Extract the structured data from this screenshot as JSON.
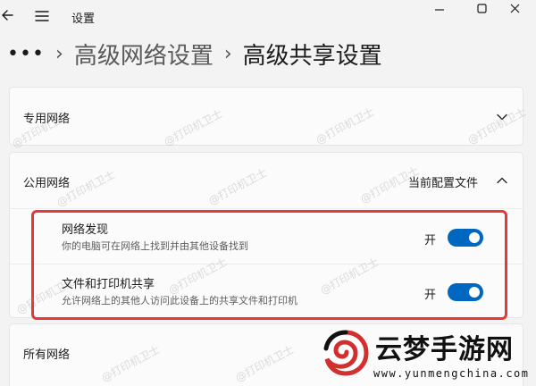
{
  "window": {
    "title": "设置",
    "icons": [
      "back-arrow-icon",
      "hamburger-menu-icon",
      "minimize-icon",
      "maximize-icon",
      "close-icon"
    ]
  },
  "breadcrumb": {
    "more": "•••",
    "items": [
      "高级网络设置",
      "高级共享设置"
    ]
  },
  "sections": {
    "private": {
      "label": "专用网络",
      "expanded": false
    },
    "public": {
      "label": "公用网络",
      "current_profile": "当前配置文件",
      "expanded": true,
      "settings": [
        {
          "title": "网络发现",
          "description": "你的电脑可在网络上找到并由其他设备找到",
          "state": "开",
          "on": true
        },
        {
          "title": "文件和打印机共享",
          "description": "允许网络上的其他人访问此设备上的共享文件和打印机",
          "state": "开",
          "on": true
        }
      ]
    },
    "all": {
      "label": "所有网络"
    }
  },
  "watermark": "@打印机卫士",
  "brand": {
    "name": "云梦手游网",
    "url": "www.yunmengchina.com"
  },
  "colors": {
    "accent": "#0067c0",
    "highlight": "#e53935",
    "background": "#f3f3f3",
    "card": "#fbfbfb"
  }
}
